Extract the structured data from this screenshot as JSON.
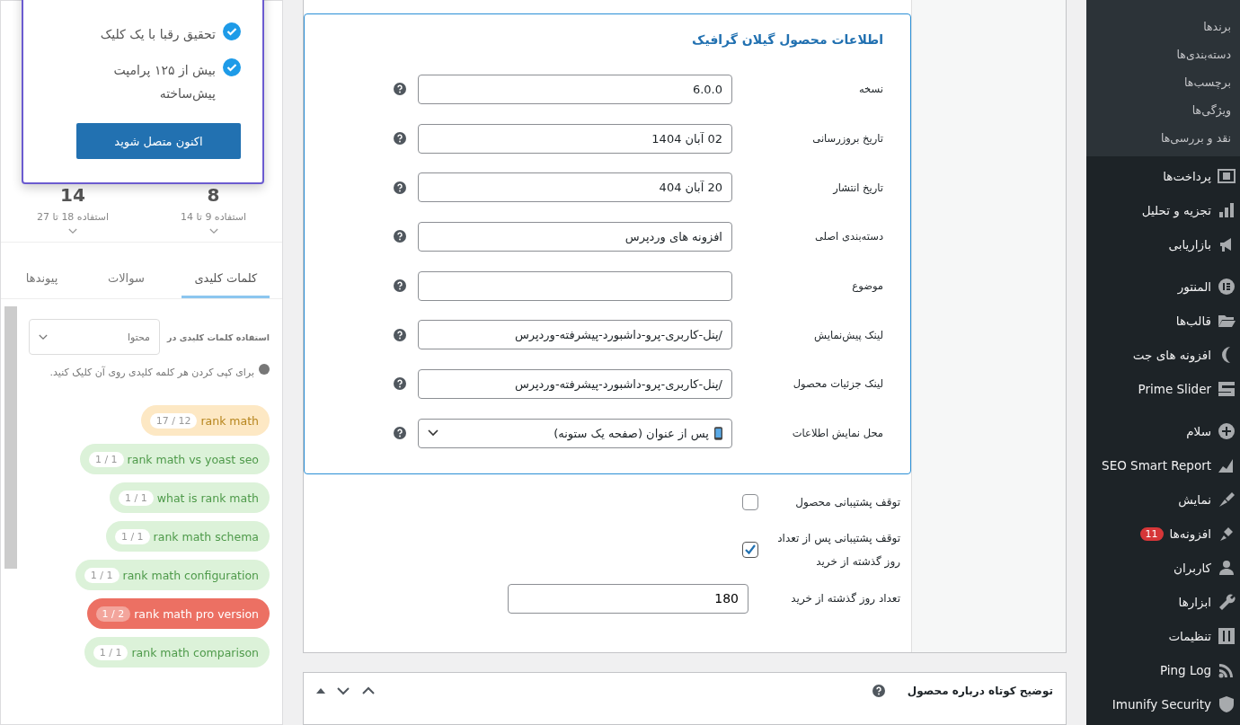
{
  "admin_menu": {
    "submenu": [
      "برندها",
      "دسته‌بندی‌ها",
      "برچسب‌ها",
      "ویژگی‌ها",
      "نقد و بررسی‌ها"
    ],
    "groups": [
      [
        {
          "label": "پرداخت‌ها"
        },
        {
          "label": "تجزیه و تحلیل"
        },
        {
          "label": "بازاریابی"
        }
      ],
      [
        {
          "label": "المنتور"
        },
        {
          "label": "قالب‌ها"
        },
        {
          "label": "افزونه های جت"
        },
        {
          "label": "Prime Slider"
        }
      ],
      [
        {
          "label": "سلام"
        },
        {
          "label": "SEO Smart Report"
        },
        {
          "label": "نمایش"
        },
        {
          "label": "افزونه‌ها",
          "badge": "11"
        },
        {
          "label": "کاربران"
        },
        {
          "label": "ابزارها"
        },
        {
          "label": "تنظیمات"
        },
        {
          "label": "Ping Log"
        },
        {
          "label": "Imunify Security"
        }
      ]
    ]
  },
  "product_info": {
    "title": "اطلاعات محصول گیلان گرافیک",
    "fields": [
      {
        "label": "نسخه",
        "value": "6.0.0",
        "kind": "text"
      },
      {
        "label": "تاریخ بروزرسانی",
        "value": "02 آبان 1404",
        "kind": "text"
      },
      {
        "label": "تاریخ انتشار",
        "value": "20 آبان 404",
        "kind": "text"
      },
      {
        "label": "دسته‌بندی اصلی",
        "value": "افزونه های وردپرس",
        "kind": "text"
      },
      {
        "label": "موضوع",
        "kind": "text"
      },
      {
        "label": "لینک پیش‌نمایش",
        "value": "/پنل-کاربری-پرو-داشبورد-پیشرفته-وردپرس",
        "kind": "text"
      },
      {
        "label": "لینک جزئیات محصول",
        "value": "/پنل-کاربری-پرو-داشبورد-پیشرفته-وردپرس",
        "kind": "text"
      },
      {
        "label": "محل نمایش اطلاعات",
        "value": "پس از عنوان (صفحه یک ستونه)",
        "kind": "select"
      }
    ]
  },
  "support": {
    "checkboxes": [
      {
        "label": "توقف پشتیبانی محصول",
        "checked": false
      },
      {
        "label": "توقف پشتیبانی پس از تعداد روز گذشته از خرید",
        "checked": true
      }
    ],
    "days": {
      "label": "تعداد روز گذشته از خرید",
      "value": "180"
    }
  },
  "next_box": {
    "title": "توضیح کوتاه درباره محصول"
  },
  "seo_panel": {
    "stats": [
      {
        "value": "8",
        "range": "استفاده 9 تا 14"
      },
      {
        "value": "14",
        "range": "استفاده 18 تا 27"
      }
    ],
    "tabs": [
      {
        "label": "کلمات کلیدی",
        "selected": true
      },
      {
        "label": "سوالات",
        "selected": false
      },
      {
        "label": "پیوندها",
        "selected": false
      }
    ],
    "filter_label": "استفاده کلمات کلیدی در",
    "filter_value": "محتوا",
    "hint": "برای کپی کردن هر کلمه کلیدی روی آن کلیک کنید.",
    "keywords": [
      {
        "text": "rank math",
        "count": "17 / 12",
        "kind": "warn"
      },
      {
        "text": "rank math vs yoast seo",
        "count": "1 / 1",
        "kind": "ok"
      },
      {
        "text": "what is rank math",
        "count": "1 / 1",
        "kind": "ok"
      },
      {
        "text": "rank math schema",
        "count": "1 / 1",
        "kind": "ok"
      },
      {
        "text": "rank math configuration",
        "count": "1 / 1",
        "kind": "ok"
      },
      {
        "text": "rank math pro version",
        "count": "1 / 2",
        "kind": "bad"
      },
      {
        "text": "rank math comparison",
        "count": "1 / 1",
        "kind": "ok"
      }
    ]
  },
  "popup": {
    "features": [
      "تحقیق رقبا با یک کلیک",
      "بیش از ۱۲۵ پرامپت پیش‌ساخته"
    ],
    "button": "اکنون متصل شوید"
  }
}
